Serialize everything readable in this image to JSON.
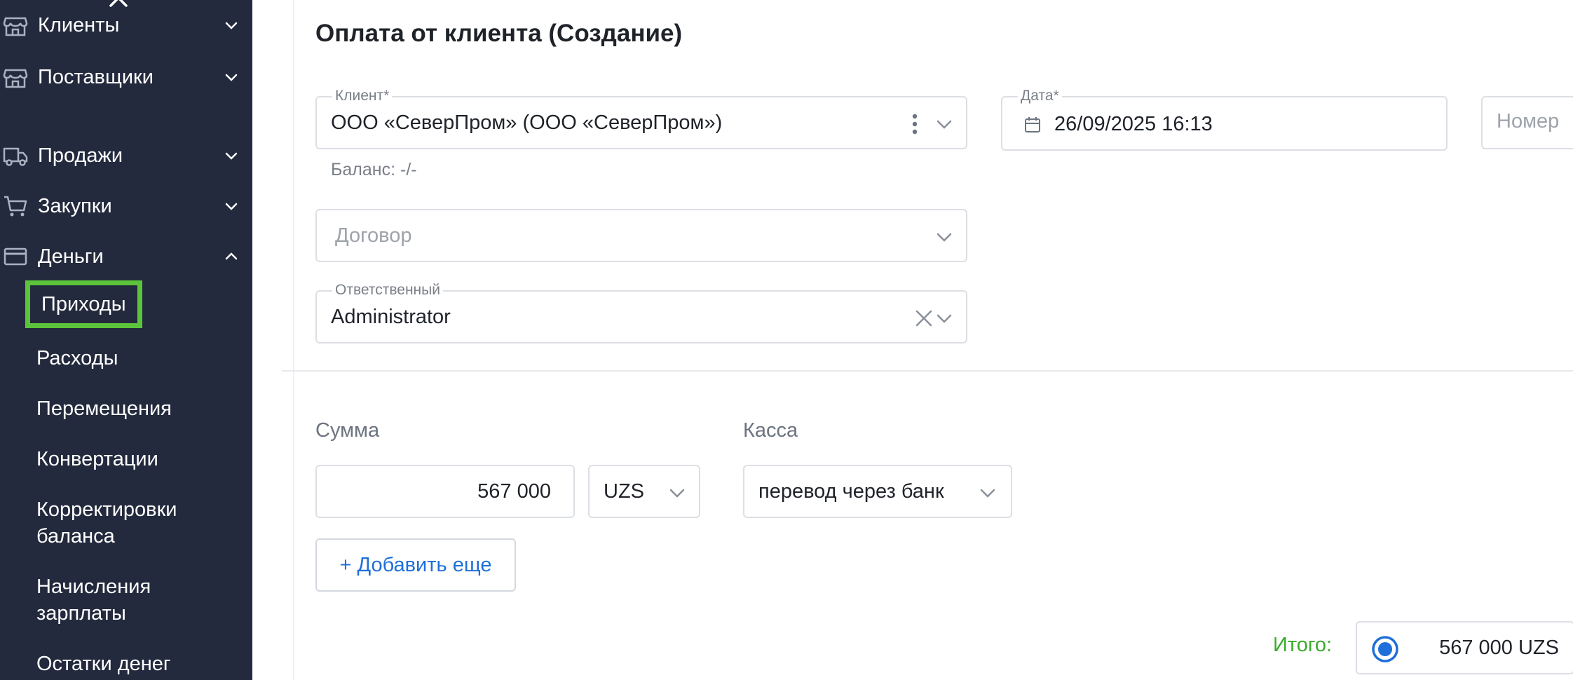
{
  "sidebar": {
    "items": [
      {
        "label": "Клиенты",
        "icon": "store-icon",
        "expanded": false
      },
      {
        "label": "Поставщики",
        "icon": "store-icon",
        "expanded": false
      },
      {
        "label": "Продажи",
        "icon": "truck-icon",
        "expanded": false
      },
      {
        "label": "Закупки",
        "icon": "cart-icon",
        "expanded": false
      },
      {
        "label": "Деньги",
        "icon": "card-icon",
        "expanded": true
      }
    ],
    "money_subitems": [
      {
        "label": "Приходы",
        "active": true
      },
      {
        "label": "Расходы"
      },
      {
        "label": "Перемещения"
      },
      {
        "label": "Конвертации"
      },
      {
        "label_line1": "Корректировки",
        "label_line2": "баланса"
      },
      {
        "label_line1": "Начисления",
        "label_line2": "зарплаты"
      },
      {
        "label": "Остатки денег"
      }
    ],
    "highlight_color": "#5cc43a"
  },
  "form": {
    "title": "Оплата от клиента (Создание)",
    "client": {
      "label": "Клиент*",
      "value": "ООО «СеверПром» (ООО «СеверПром»)"
    },
    "balance": "Баланс: -/-",
    "date": {
      "label": "Дата*",
      "value": "26/09/2025 16:13"
    },
    "number": {
      "placeholder": "Номер"
    },
    "contract": {
      "placeholder": "Договор"
    },
    "responsible": {
      "label": "Ответственный",
      "value": "Administrator"
    },
    "amount_label": "Сумма",
    "amount_value": "567 000",
    "currency": "UZS",
    "cash_label": "Касса",
    "cash_value": "перевод через банк",
    "add_more": "+ Добавить еще",
    "total_label": "Итого:",
    "total_value": "567 000 UZS"
  },
  "colors": {
    "sidebar_bg": "#232a3d",
    "accent_blue": "#1e6fd9",
    "total_green": "#3aab2c"
  }
}
